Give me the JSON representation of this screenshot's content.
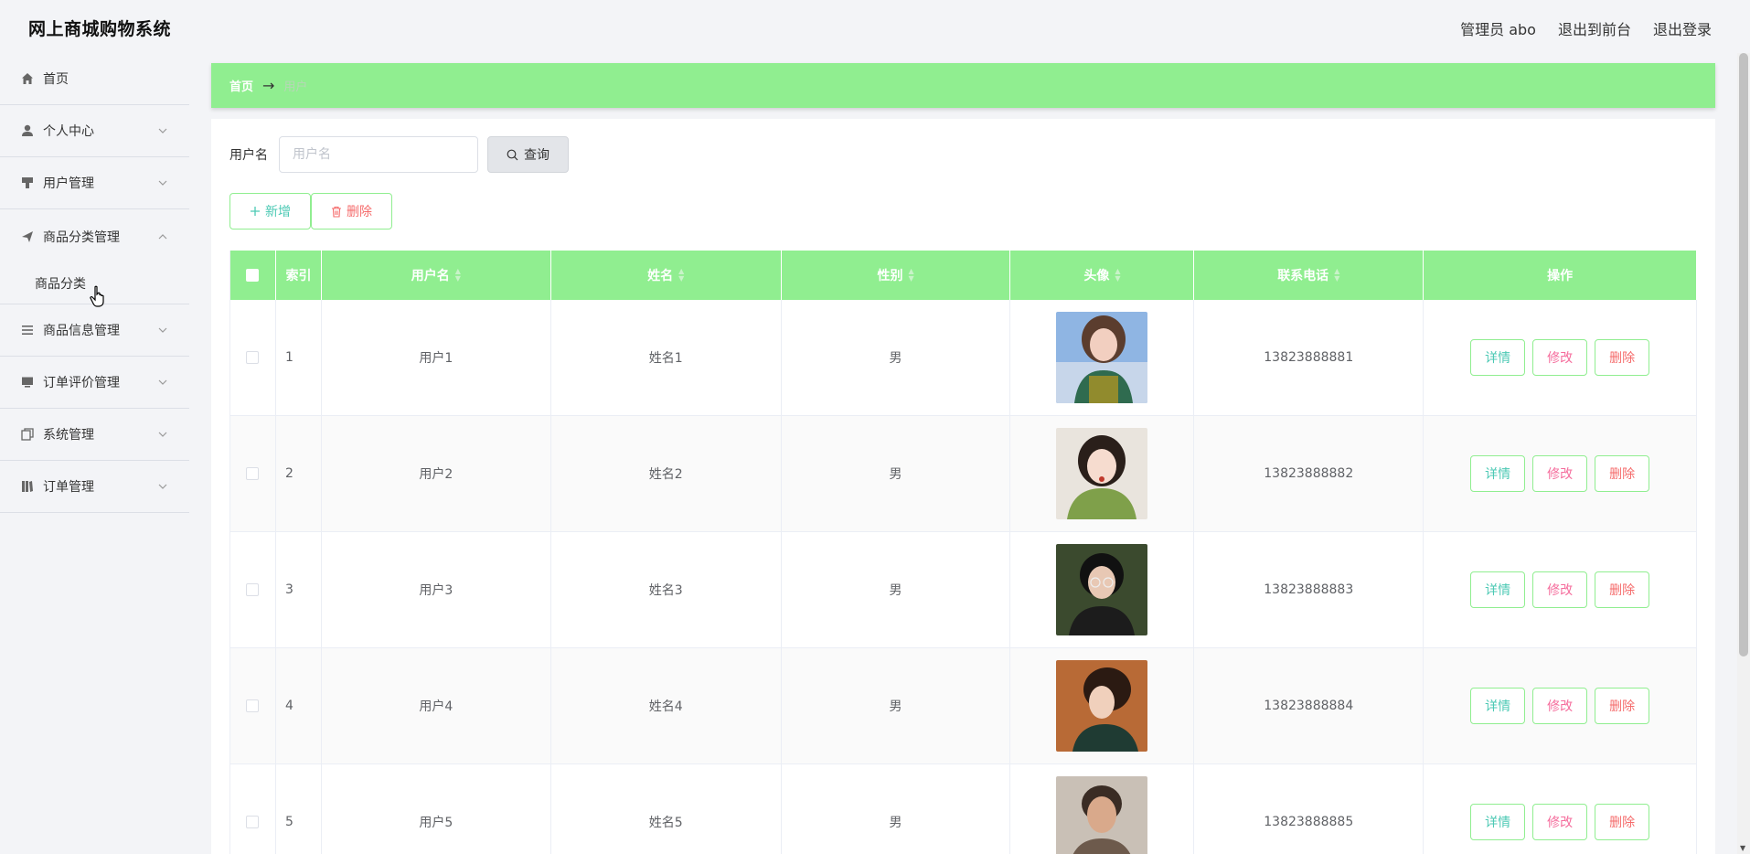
{
  "header": {
    "title": "网上商城购物系统",
    "user": "管理员 abo",
    "to_front": "退出到前台",
    "logout": "退出登录"
  },
  "sidebar": {
    "items": [
      {
        "label": "首页",
        "icon": "home-icon"
      },
      {
        "label": "个人中心",
        "icon": "user-icon"
      },
      {
        "label": "用户管理",
        "icon": "brush-icon"
      },
      {
        "label": "商品分类管理",
        "icon": "send-icon",
        "expanded": true,
        "children": [
          "商品分类"
        ]
      },
      {
        "label": "商品信息管理",
        "icon": "list-icon"
      },
      {
        "label": "订单评价管理",
        "icon": "monitor-icon"
      },
      {
        "label": "系统管理",
        "icon": "copy-icon"
      },
      {
        "label": "订单管理",
        "icon": "book-icon"
      }
    ]
  },
  "breadcrumb": {
    "home": "首页",
    "separator": "→",
    "current": "用户"
  },
  "search": {
    "label": "用户名",
    "placeholder": "用户名",
    "value": "",
    "button": "查询"
  },
  "actions": {
    "add": "新增",
    "delete": "删除"
  },
  "table": {
    "columns": [
      "索引",
      "用户名",
      "姓名",
      "性别",
      "头像",
      "联系电话",
      "操作"
    ],
    "rows": [
      {
        "index": "1",
        "username": "用户1",
        "name": "姓名1",
        "gender": "男",
        "phone": "13823888881"
      },
      {
        "index": "2",
        "username": "用户2",
        "name": "姓名2",
        "gender": "男",
        "phone": "13823888882"
      },
      {
        "index": "3",
        "username": "用户3",
        "name": "姓名3",
        "gender": "男",
        "phone": "13823888883"
      },
      {
        "index": "4",
        "username": "用户4",
        "name": "姓名4",
        "gender": "男",
        "phone": "13823888884"
      },
      {
        "index": "5",
        "username": "用户5",
        "name": "姓名5",
        "gender": "男",
        "phone": "13823888885"
      }
    ],
    "ops": {
      "detail": "详情",
      "edit": "修改",
      "delete": "删除"
    }
  },
  "colors": {
    "accent": "#90ee90",
    "teal": "#4cc9b4",
    "danger": "#f56c6c"
  }
}
